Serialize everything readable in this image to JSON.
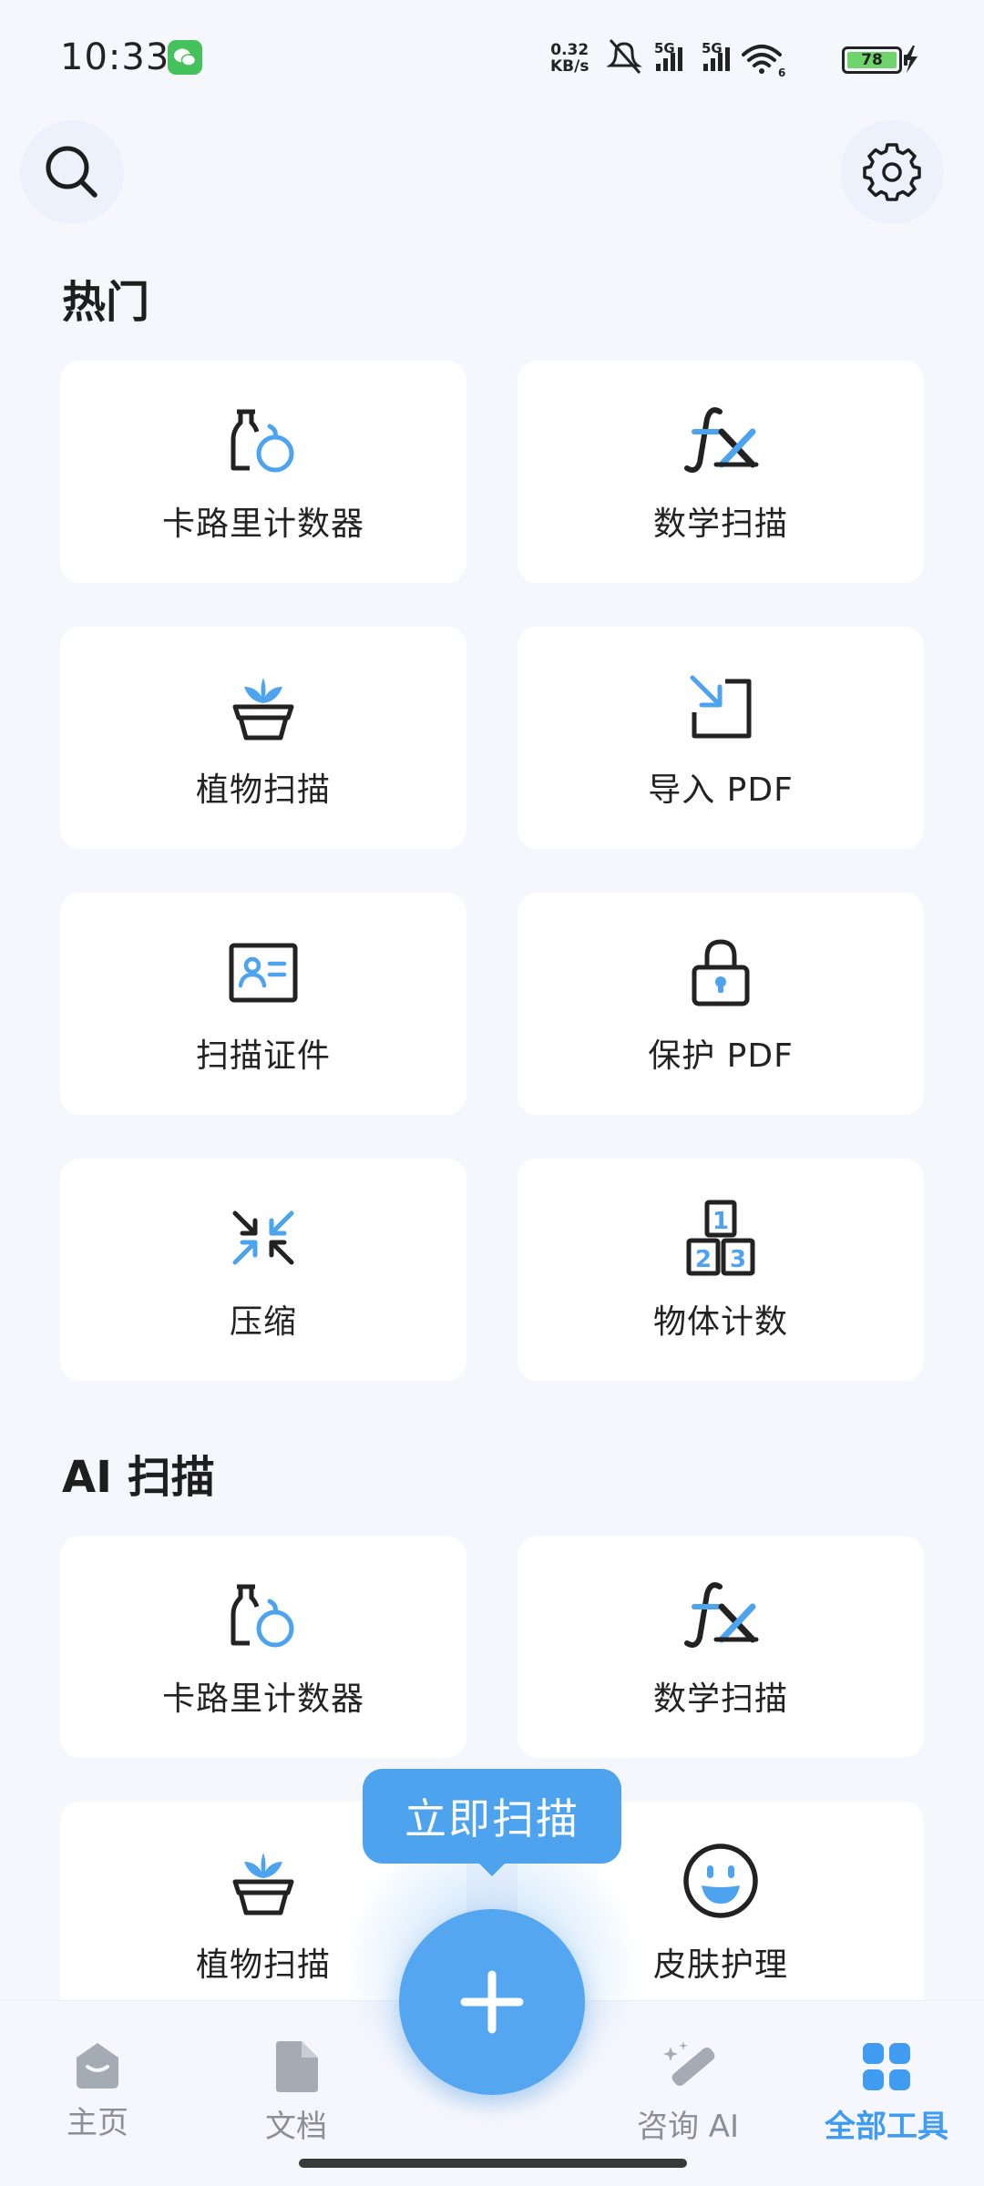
{
  "status_bar": {
    "time": "10:33",
    "net_speed_value": "0.32",
    "net_speed_unit": "KB/s",
    "signal1": "5G",
    "signal2": "5G",
    "wifi_badge": "6",
    "battery": "78"
  },
  "header": {
    "search_icon": "search-icon",
    "settings_icon": "gear-icon"
  },
  "sections": [
    {
      "title": "热门",
      "items": [
        {
          "label": "卡路里计数器",
          "icon": "calorie-icon"
        },
        {
          "label": "数学扫描",
          "icon": "fx-icon"
        },
        {
          "label": "植物扫描",
          "icon": "plant-icon"
        },
        {
          "label": "导入 PDF",
          "icon": "import-icon"
        },
        {
          "label": "扫描证件",
          "icon": "id-card-icon"
        },
        {
          "label": "保护 PDF",
          "icon": "lock-icon"
        },
        {
          "label": "压缩",
          "icon": "compress-icon"
        },
        {
          "label": "物体计数",
          "icon": "count-blocks-icon"
        }
      ]
    },
    {
      "title": "AI 扫描",
      "items": [
        {
          "label": "卡路里计数器",
          "icon": "calorie-icon"
        },
        {
          "label": "数学扫描",
          "icon": "fx-icon"
        },
        {
          "label": "植物扫描",
          "icon": "plant-icon"
        },
        {
          "label": "皮肤护理",
          "icon": "smile-icon"
        }
      ]
    }
  ],
  "scan_now": "立即扫描",
  "nav": [
    {
      "label": "主页",
      "icon": "home-icon",
      "active": false
    },
    {
      "label": "文档",
      "icon": "document-icon",
      "active": false
    },
    {
      "label": "咨询 AI",
      "icon": "magic-wand-icon",
      "active": false
    },
    {
      "label": "全部工具",
      "icon": "grid-icon",
      "active": true
    }
  ],
  "colors": {
    "accent": "#4da3ee",
    "icon_dark": "#222222",
    "background": "#f6f7fc"
  }
}
